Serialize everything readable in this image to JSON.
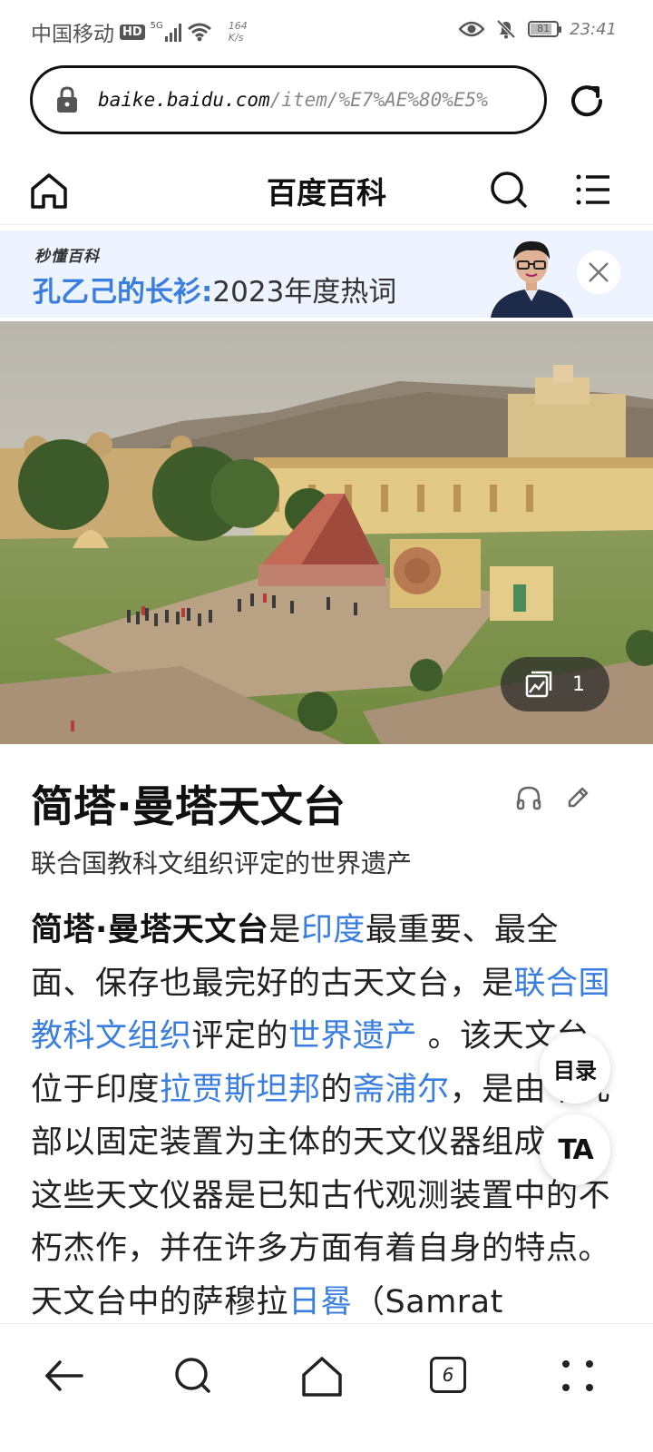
{
  "status_bar": {
    "carrier": "中国移动",
    "hd": "HD",
    "network": "5G",
    "speed_value": "164",
    "speed_unit": "K/s",
    "battery": "81",
    "time": "23:41"
  },
  "browser": {
    "url_domain": "baike.baidu.com",
    "url_path": "/item/%E7%AE%80%E5%"
  },
  "header": {
    "title": "百度百科"
  },
  "banner": {
    "brand": "秒懂百科",
    "highlight": "孔乙己的长衫:",
    "rest": "2023年度热词"
  },
  "hero": {
    "image_count": "1"
  },
  "article": {
    "title": "简塔·曼塔天文台",
    "subtitle": "联合国教科文组织评定的世界遗产",
    "p_bold": "简塔·曼塔天文台",
    "p1": "是",
    "link_india": "印度",
    "p2": "最重要、最全面、保存也最完好的古天文台，是",
    "link_unesco": "联合国教科文组织",
    "p3": "评定的",
    "link_heritage": "世界遗产",
    "p4": " 。该天文台位于印度",
    "link_rajasthan": "拉贾斯坦邦",
    "p5": "的",
    "link_jaipur": "斋浦尔",
    "p6": "，是由十几部以固定装置为主体的天文仪器组成的，这些天文仪器是已知古代观测装置中的不朽杰作，并在许多方面有着自身的特点。天文台中的萨穆拉",
    "link_sundial": "日晷",
    "p7": "（Samrat"
  },
  "floating": {
    "toc": "目录",
    "font": "TA"
  },
  "bottom_nav": {
    "tab_count": "6"
  },
  "colors": {
    "link": "#3a7ee0",
    "banner_bg": "#eef4ff"
  }
}
